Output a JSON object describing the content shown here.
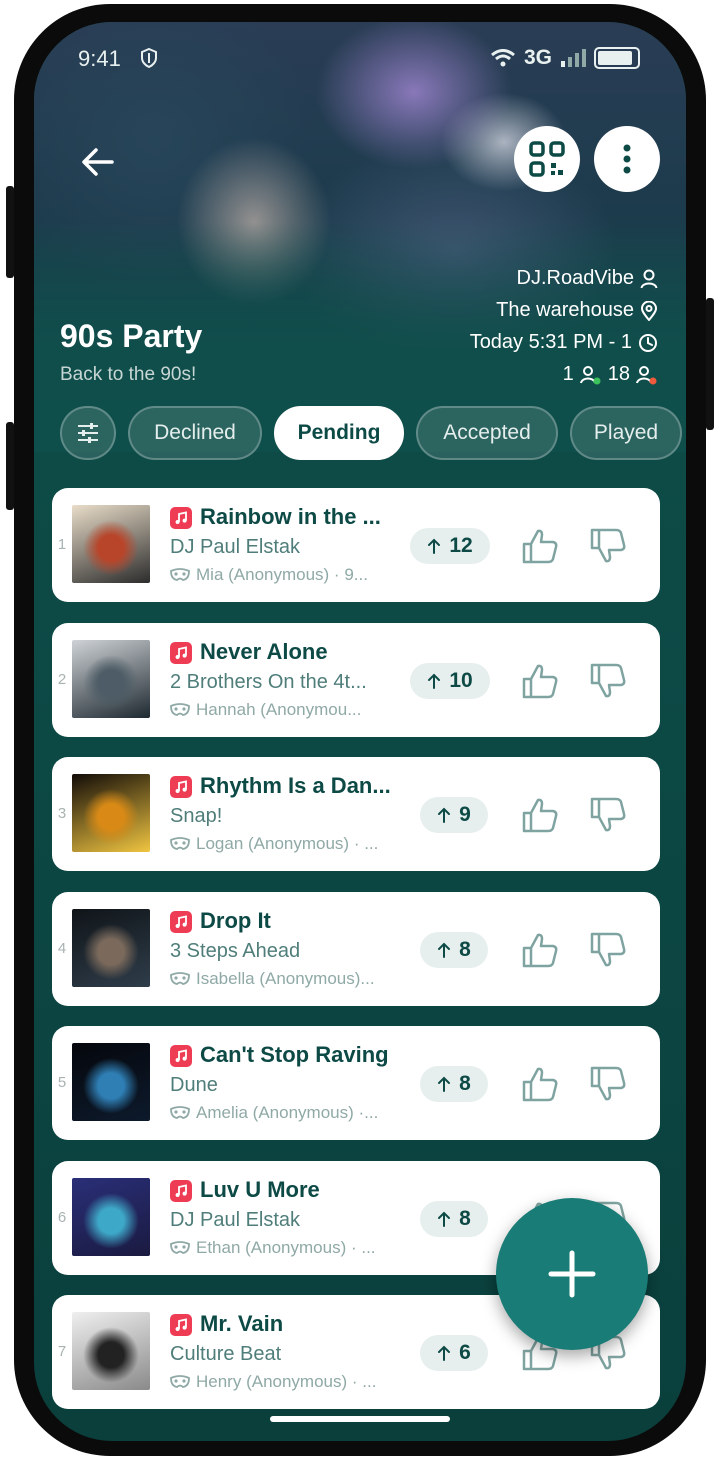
{
  "status_bar": {
    "time": "9:41",
    "network": "3G"
  },
  "event": {
    "title": "90s Party",
    "subtitle": "Back to the 90s!",
    "dj": "DJ.RoadVibe",
    "venue": "The warehouse",
    "schedule": "Today 5:31 PM - 1",
    "online_count": "1",
    "offline_count": "18"
  },
  "tabs": [
    {
      "label": "Declined"
    },
    {
      "label": "Pending",
      "active": true
    },
    {
      "label": "Accepted"
    },
    {
      "label": "Played"
    }
  ],
  "requests": [
    {
      "rank": "1",
      "title": "Rainbow in the ...",
      "artist": "DJ Paul Elstak",
      "requester": "Mia (Anonymous) · 9...",
      "votes": "12",
      "cover_colors": [
        "#e9ddc9",
        "#b8452a",
        "#2c2c2c"
      ]
    },
    {
      "rank": "2",
      "title": "Never Alone",
      "artist": "2 Brothers On the 4t...",
      "requester": "Hannah (Anonymou...",
      "votes": "10",
      "cover_colors": [
        "#cfd3d6",
        "#4d5c66",
        "#1e2930"
      ]
    },
    {
      "rank": "3",
      "title": "Rhythm Is a Dan...",
      "artist": "Snap!",
      "requester": "Logan (Anonymous) · ...",
      "votes": "9",
      "cover_colors": [
        "#120c08",
        "#d98a16",
        "#f0c541"
      ]
    },
    {
      "rank": "4",
      "title": "Drop It",
      "artist": "3 Steps Ahead",
      "requester": "Isabella (Anonymous)...",
      "votes": "8",
      "cover_colors": [
        "#0f1418",
        "#7b6a5c",
        "#2f3d4a"
      ]
    },
    {
      "rank": "5",
      "title": "Can't Stop Raving",
      "artist": "Dune",
      "requester": "Amelia (Anonymous) ·...",
      "votes": "8",
      "cover_colors": [
        "#05070c",
        "#2f7fb5",
        "#0d1a2c"
      ]
    },
    {
      "rank": "6",
      "title": "Luv U More",
      "artist": "DJ Paul Elstak",
      "requester": "Ethan (Anonymous) · ...",
      "votes": "8",
      "cover_colors": [
        "#2a2f78",
        "#3ea8c8",
        "#1a1a40"
      ]
    },
    {
      "rank": "7",
      "title": "Mr. Vain",
      "artist": "Culture Beat",
      "requester": "Henry (Anonymous) · ...",
      "votes": "6",
      "cover_colors": [
        "#efefef",
        "#222222",
        "#8a8a8a"
      ]
    }
  ],
  "colors": {
    "primary": "#0d4a46",
    "accent": "#1a7c76",
    "apple_music": "#ef3c55"
  },
  "icons": {
    "back": "arrow-left-icon",
    "qr": "qr-code-icon",
    "menu": "more-vertical-icon",
    "add": "plus-icon"
  }
}
